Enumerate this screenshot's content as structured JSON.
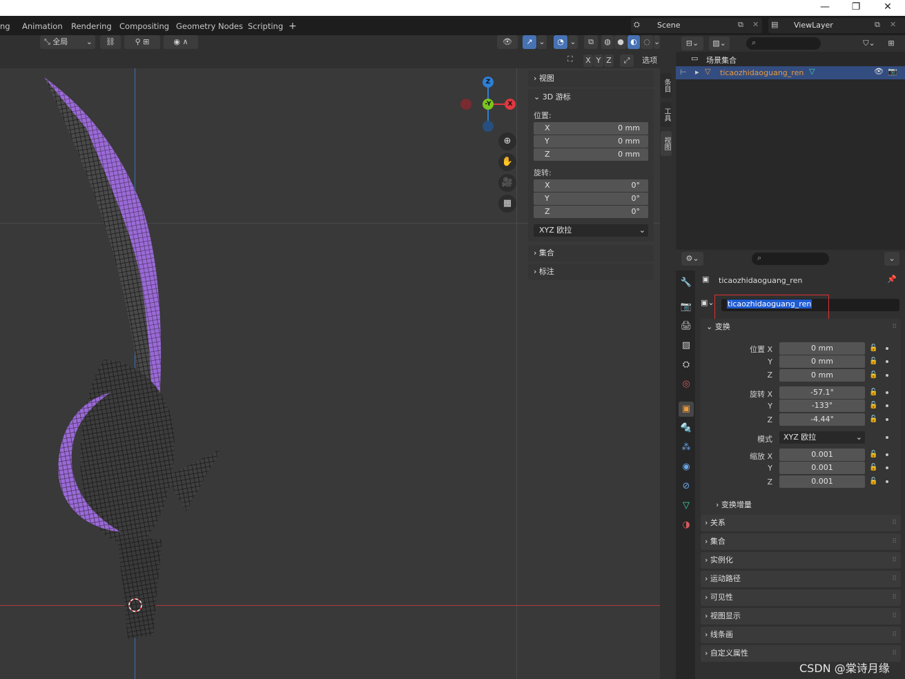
{
  "window": {
    "minimize": "—",
    "restore": "❐",
    "close": "✕"
  },
  "topbar": {
    "tabs": [
      "ng",
      "Animation",
      "Rendering",
      "Compositing",
      "Geometry Nodes",
      "Scripting"
    ],
    "add_tab": "+",
    "scene_name": "Scene",
    "view_layer": "ViewLayer"
  },
  "viewport": {
    "orientation": "全局",
    "axes": [
      "X",
      "Y",
      "Z"
    ],
    "options_label": "选项",
    "gizmo": {
      "x": "X",
      "y": "-Y",
      "z": "Z"
    }
  },
  "npanel": {
    "view_label": "视图",
    "cursor_label": "3D 游标",
    "location_label": "位置:",
    "location": [
      {
        "axis": "X",
        "value": "0 mm"
      },
      {
        "axis": "Y",
        "value": "0 mm"
      },
      {
        "axis": "Z",
        "value": "0 mm"
      }
    ],
    "rotation_label": "旋转:",
    "rotation": [
      {
        "axis": "X",
        "value": "0°"
      },
      {
        "axis": "Y",
        "value": "0°"
      },
      {
        "axis": "Z",
        "value": "0°"
      }
    ],
    "rotation_mode": "XYZ 欧拉",
    "collection_label": "集合",
    "annotation_label": "标注",
    "side_tabs": [
      "条目",
      "工具",
      "视图"
    ]
  },
  "outliner": {
    "scene_collection": "场景集合",
    "object_name": "ticaozhidaoguang_ren"
  },
  "properties": {
    "object_name": "ticaozhidaoguang_ren",
    "name_field": "ticaozhidaoguang_ren",
    "transform_label": "变换",
    "loc_label": "位置 X",
    "rot_label": "旋转 X",
    "mode_label": "模式",
    "scale_label": "缩放 X",
    "y_label": "Y",
    "z_label": "Z",
    "location": [
      "0 mm",
      "0 mm",
      "0 mm"
    ],
    "rotation": [
      "-57.1°",
      "-133°",
      "-4.44°"
    ],
    "mode_value": "XYZ 欧拉",
    "scale": [
      "0.001",
      "0.001",
      "0.001"
    ],
    "delta_label": "变换增量",
    "sections": [
      "关系",
      "集合",
      "实例化",
      "运动路径",
      "可见性",
      "视图显示",
      "线条画",
      "自定义属性"
    ]
  },
  "watermark": "CSDN @棠诗月缘",
  "colors": {
    "accent": "#4772b3",
    "selection_text": "#1f5bd1",
    "object_orange": "#e89a3c",
    "blade_purple": "#9b6ad8",
    "x_axis_red": "#e0383f",
    "y_axis_green": "#7ac51f",
    "z_axis_blue": "#2d7fd6",
    "highlight_box": "#e03030"
  }
}
